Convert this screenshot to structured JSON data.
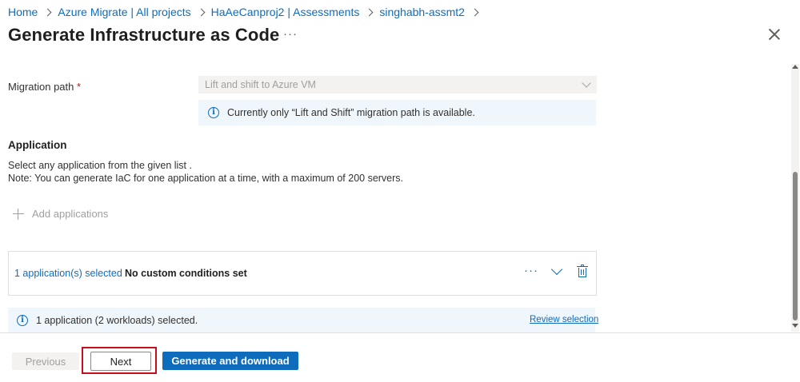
{
  "breadcrumb": {
    "items": [
      "Home",
      "Azure Migrate | All projects",
      "HaAeCanproj2 | Assessments",
      "singhabh-assmt2"
    ]
  },
  "header": {
    "title": "Generate Infrastructure as Code",
    "more_label": "···"
  },
  "migration": {
    "label": "Migration path",
    "required_mark": "*",
    "selected_value": "Lift and shift to Azure VM",
    "info_text": "Currently only “Lift and Shift” migration path is available."
  },
  "application": {
    "heading": "Application",
    "description_line1": "Select any application from the given list .",
    "description_line2": "Note: You can generate IaC for one application at a time, with a maximum of 200 servers.",
    "add_label": "Add applications"
  },
  "selection_card": {
    "selected_link": "1 application(s) selected",
    "conditions_text": "No custom conditions set",
    "more_label": "···"
  },
  "summary": {
    "info_text": "1 application (2 workloads) selected.",
    "review_link": "Review selection"
  },
  "footer": {
    "previous_label": "Previous",
    "next_label": "Next",
    "generate_label": "Generate and download"
  },
  "colors": {
    "accent": "#0f6cbd",
    "highlight_border": "#c50f1f",
    "info_background": "#eff6fc"
  }
}
